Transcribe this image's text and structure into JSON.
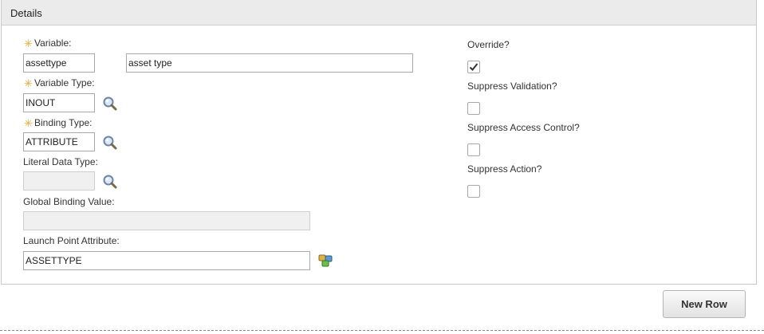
{
  "panel": {
    "title": "Details"
  },
  "fields": {
    "variable": {
      "label": "Variable:",
      "value": "assettype",
      "description": "asset type"
    },
    "variable_type": {
      "label": "Variable Type:",
      "value": "INOUT"
    },
    "binding_type": {
      "label": "Binding Type:",
      "value": "ATTRIBUTE"
    },
    "literal_data_type": {
      "label": "Literal Data Type:",
      "value": ""
    },
    "global_binding_value": {
      "label": "Global Binding Value:",
      "value": ""
    },
    "launch_point_attribute": {
      "label": "Launch Point Attribute:",
      "value": "ASSETTYPE"
    }
  },
  "options": {
    "override": {
      "label": "Override?",
      "checked": true
    },
    "suppress_validation": {
      "label": "Suppress Validation?",
      "checked": false
    },
    "suppress_access_control": {
      "label": "Suppress Access Control?",
      "checked": false
    },
    "suppress_action": {
      "label": "Suppress Action?",
      "checked": false
    }
  },
  "required_marker": "✳",
  "icons": {
    "lookup": "magnifier-icon",
    "attribute_picker": "attribute-lookup-icon"
  },
  "colors": {
    "required": "#f5a623",
    "header_bg": "#ebebeb"
  },
  "buttons": {
    "new_row": "New Row"
  }
}
